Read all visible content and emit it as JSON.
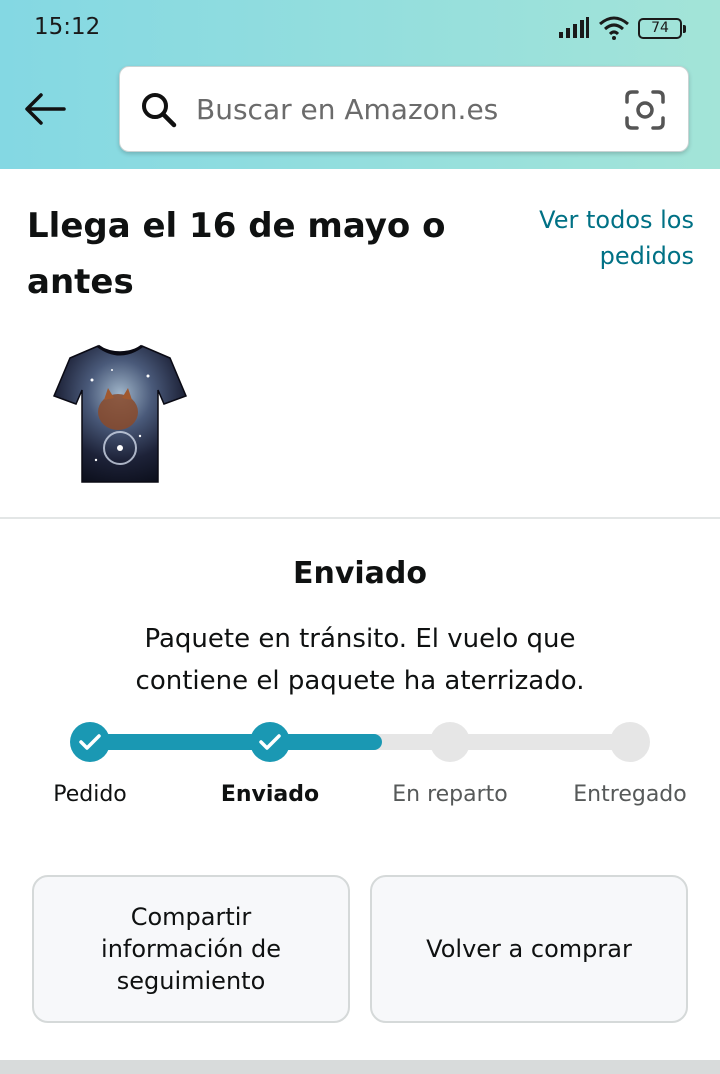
{
  "status_bar": {
    "time": "15:12",
    "battery": "74",
    "icons": [
      "signal-icon",
      "wifi-icon",
      "battery-icon"
    ]
  },
  "header": {
    "back_icon": "back-arrow-icon",
    "search": {
      "placeholder": "Buscar en Amazon.es",
      "icon": "search-icon",
      "camera_icon": "camera-scan-icon"
    }
  },
  "order": {
    "delivery_title": "Llega el 16 de mayo o antes",
    "all_orders_link": "Ver todos los pedidos",
    "product_image": "galaxy-fox-tshirt"
  },
  "tracking": {
    "status": "Enviado",
    "detail": "Paquete en tránsito. El vuelo que contiene el paquete ha aterrizado.",
    "progress": 0.5,
    "steps": [
      {
        "label": "Pedido",
        "done": true
      },
      {
        "label": "Enviado",
        "done": true,
        "current": true
      },
      {
        "label": "En reparto",
        "done": false
      },
      {
        "label": "Entregado",
        "done": false
      }
    ]
  },
  "actions": {
    "share_tracking": "Compartir información de seguimiento",
    "buy_again": "Volver a comprar"
  },
  "colors": {
    "header_gradient_start": "#84d8e3",
    "header_gradient_end": "#a3e4d8",
    "progress": "#1a98b3",
    "link": "#007185"
  }
}
